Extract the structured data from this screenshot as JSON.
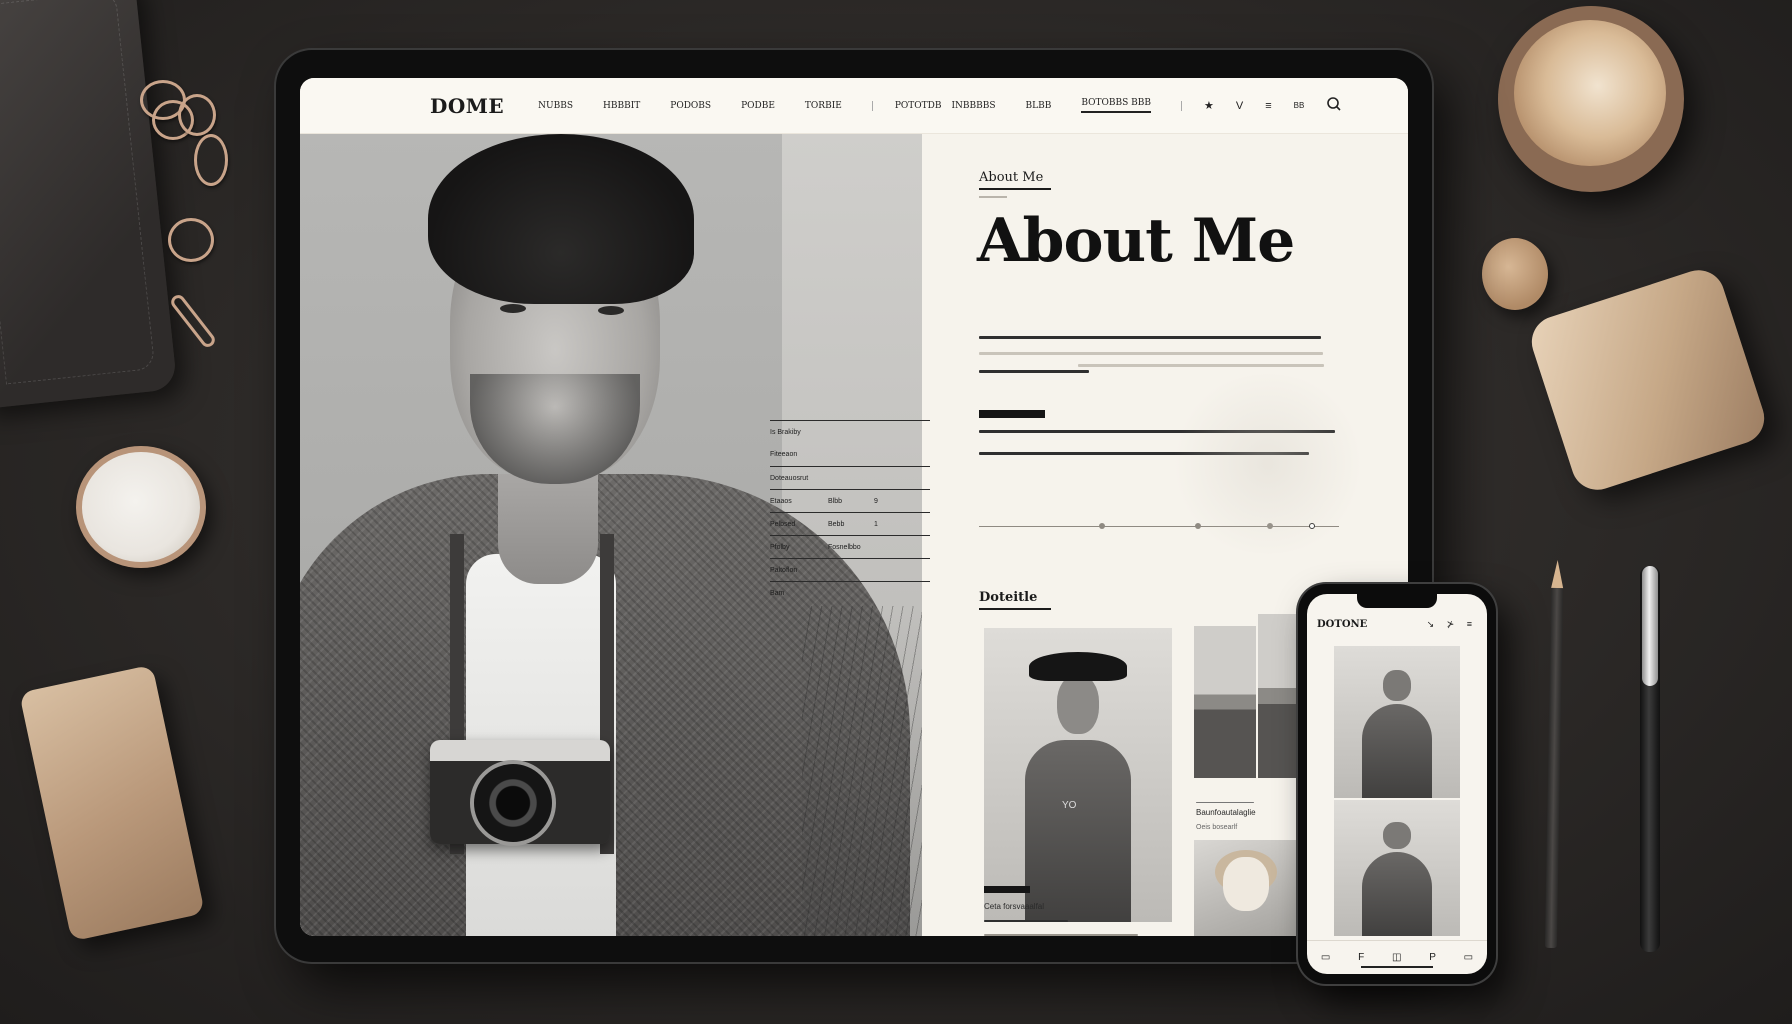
{
  "site": {
    "logo": "DOME",
    "nav": [
      "NUBBS",
      "HBBBIT",
      "PODOBS",
      "PODBE",
      "TORBIE",
      "POTOTDB",
      "INBBBBS",
      "BLBB",
      "BOTOBBS BBB"
    ],
    "nav_active_index": 8,
    "nav_icons": [
      "★",
      "V",
      "≡",
      "BB"
    ],
    "search_icon": "search-icon"
  },
  "about": {
    "eyebrow": "About Me",
    "title": "About Me",
    "text_lines_para1": 3,
    "section_title": "Doteitle"
  },
  "info_table": {
    "rows": [
      {
        "k": "Is Brakiby",
        "v": "",
        "n": ""
      },
      {
        "k": "Fiteeaon",
        "v": "",
        "n": ""
      },
      {
        "k": "Doteauosrut",
        "v": "",
        "n": ""
      },
      {
        "k": "Etaaos",
        "v": "Blbb",
        "n": "9"
      },
      {
        "k": "Pelbsed",
        "v": "Bebb",
        "n": "1"
      },
      {
        "k": "Pfolby",
        "v": "Fosnelbbo",
        "n": ""
      },
      {
        "k": "Paltoflon",
        "v": "",
        "n": ""
      },
      {
        "k": "Bam",
        "v": "",
        "n": ""
      }
    ]
  },
  "gallery": {
    "caption_1": "Baunfoautalaglie",
    "caption_2": "Oeis bosearlf",
    "footer_caption": "Ceta forsvaaalfal",
    "tee_text": "YO"
  },
  "phone": {
    "logo": "DOTONE",
    "icons": "↘ ⊁ ≡",
    "tabbar": [
      "▭",
      "F",
      "◫",
      "P",
      "▭"
    ]
  },
  "colors": {
    "background": "#2c2927",
    "page": "#f6f3ec",
    "ink": "#1b1b1b"
  }
}
